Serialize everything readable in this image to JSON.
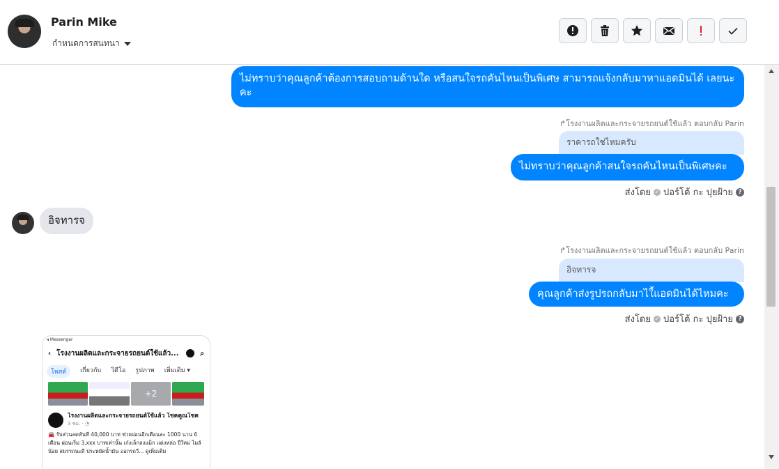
{
  "header": {
    "name": "Parin Mike",
    "subtitle": "กำหนดการสนทนา",
    "actions": [
      {
        "icon": "alert-circle-icon",
        "color": "#1c1e21"
      },
      {
        "icon": "trash-icon",
        "color": "#1c1e21"
      },
      {
        "icon": "star-icon",
        "color": "#1c1e21"
      },
      {
        "icon": "envelope-icon",
        "color": "#1c1e21"
      },
      {
        "icon": "exclamation-icon",
        "color": "#e02020"
      },
      {
        "icon": "checkmark-icon",
        "color": "#1c1e21"
      }
    ]
  },
  "messages": {
    "m1": {
      "text": "ไม่ทราบว่าคุณลูกค้าต้องการสอบถามด้านใด หรือสนใจรถคันไหนเป็นพิเศษ สามารถแจ้งกลับมาหาแอดมินได้ เลยนะคะ"
    },
    "m2": {
      "reply_meta": "โรงงานผลิตและกระจายรถยนต์ใช้แล้ว ตอบกลับ Parin",
      "quoted": "ราคารถใช่ไหมครับ",
      "text": "ไม่ทราบว่าคุณลูกค้าสนใจรถคันไหนเป็นพิเศษคะ",
      "sent_by_label": "ส่งโดย",
      "sender": "ปอร์โต้ กะ ปุยฝ้าย"
    },
    "m3": {
      "text": "อิจทารจ"
    },
    "m4": {
      "reply_meta": "โรงงานผลิตและกระจายรถยนต์ใช้แล้ว ตอบกลับ Parin",
      "quoted": "อิจทารจ",
      "text": "คุณลูกค้าส่งรูปรถกลับมาไใ้แอดมินได้ไหมคะ",
      "sent_by_label": "ส่งโดย",
      "sender": "ปอร์โต้ กะ ปุยฝ้าย"
    }
  },
  "attachment": {
    "top_label": "◂ Messenger",
    "page_title": "โรงงานผลิตและกระจายรถยนต์ใช้แล้ว...",
    "tabs": [
      "โพสต์",
      "เกี่ยวกับ",
      "วิดีโอ",
      "รูปภาพ",
      "เพิ่มเติม ▾"
    ],
    "more_count": "+2",
    "post_title": "โรงงานผลิตและกระจายรถยนต์ใช้แล้ว โชคคูณโชค",
    "post_time": "3 ชม. · ◔",
    "post_body": "🚘 รับส่วนลดทันที 40,000 บาท ช่วยผ่อนอีกเดือนละ 1000 นาน 6 เดือน ผ่อนเริ่ม 3,xxx บาทเท่านั้น เก๋งเล็กลงแม็ก แต่งหล่อ ปีใหม่ ไมล์น้อย สมรรถนะดี ประหยัดน้ำมัน ออกรถวี... ดูเพิ่มเติม"
  }
}
